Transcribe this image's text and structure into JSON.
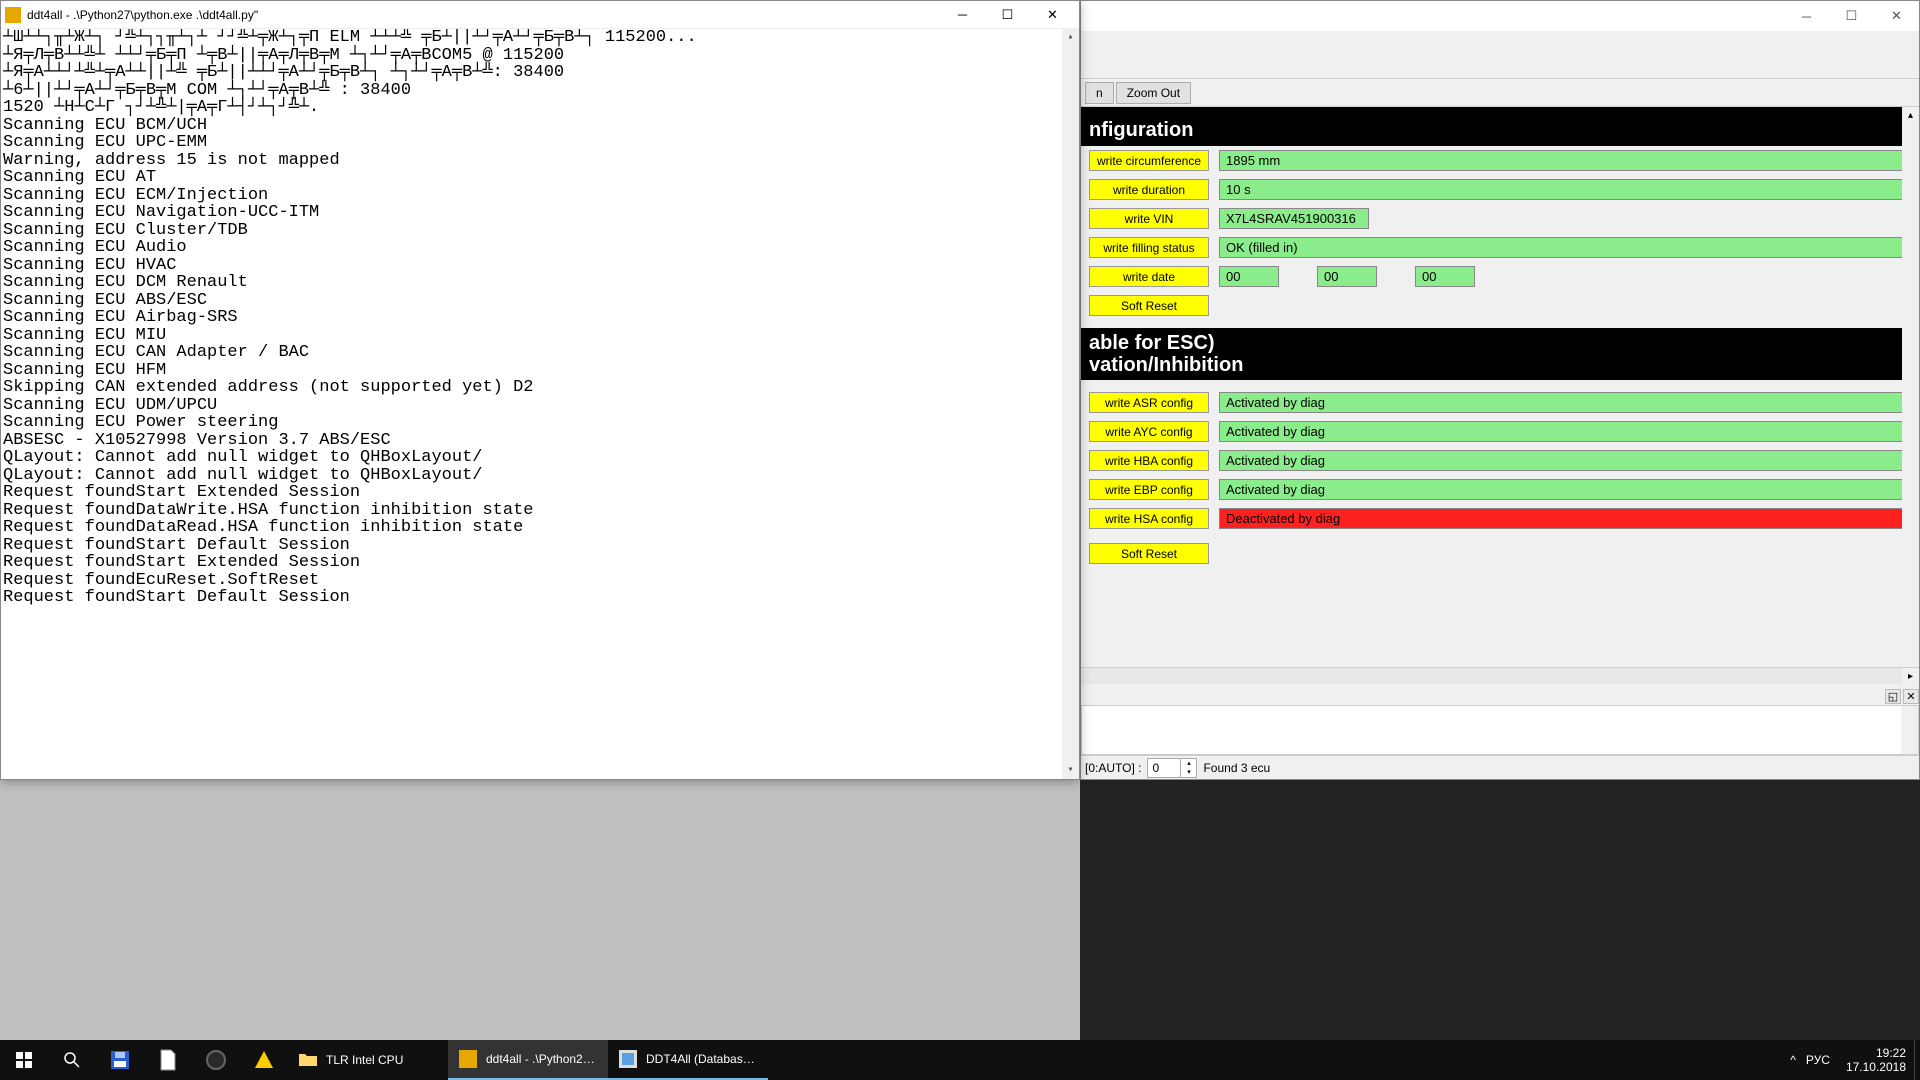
{
  "console": {
    "title": "ddt4all - .\\Python27\\python.exe .\\ddt4all.py\"",
    "lines": [
      "┴Ш┴┴┐╥┴Ж┴┐ ┘╩┴┐┐╥┴┐┴ ┘┘╩┴╤Ж┴┐╤П ELM ┴┴┴╩ ╤Б┴||┴┘╤А┴┘╤Б╤В┴┐  115200...",
      "┴Я╤Л╤В┴┴╩┴ ┴┴┘╤Б╤П ┴╤В┴||╤А╤Л╤В╤М ┴┐┴┘╤А╤ВCOM5 @ 115200",
      "┴Я╤А┴┴┘┴╩┴╤А┴┴||┴╩ ╤Б┴||┴┴┘╤А┴┘╤Б╤В┴┐ ┴┐┴┘╤А╤В┴╩: 38400",
      "┴6┴||┴┘╤А┴┘╤Б╤В╤М COM ┴┐┴┘╤А╤В┴╩ : 38400",
      "1520 ┴Н┴С┴Г ┐┘┴╩┴|╤А╤Г┴┤┘┴┐┘╩┴.",
      "Scanning ECU BCM/UCH",
      "Scanning ECU UPC-EMM",
      "Warning, address 15 is not mapped",
      "Scanning ECU AT",
      "Scanning ECU ECM/Injection",
      "Scanning ECU Navigation-UCC-ITM",
      "Scanning ECU Cluster/TDB",
      "Scanning ECU Audio",
      "Scanning ECU HVAC",
      "Scanning ECU DCM Renault",
      "Scanning ECU ABS/ESC",
      "Scanning ECU Airbag-SRS",
      "Scanning ECU MIU",
      "Scanning ECU CAN Adapter / BAC",
      "Scanning ECU HFM",
      "Skipping CAN extended address (not supported yet)  D2",
      "Scanning ECU UDM/UPCU",
      "Scanning ECU Power steering",
      "ABSESC - X10527998 Version 3.7 ABS/ESC",
      "QLayout: Cannot add null widget to QHBoxLayout/",
      "QLayout: Cannot add null widget to QHBoxLayout/",
      "Request foundStart Extended Session",
      "Request foundDataWrite.HSA function inhibition state",
      "Request foundDataRead.HSA function inhibition state",
      "Request foundStart Default Session",
      "Request foundStart Extended Session",
      "Request foundEcuReset.SoftReset",
      "Request foundStart Default Session"
    ]
  },
  "ddt": {
    "toolbar": {
      "zoom_in_partial": "n",
      "zoom_out": "Zoom Out"
    },
    "sections": {
      "config_title": "nfiguration",
      "esc_title1": "able for ESC)",
      "esc_title2": "vation/Inhibition"
    },
    "config_rows": [
      {
        "btn": "write circumference",
        "val": "1895 mm"
      },
      {
        "btn": "write duration",
        "val": "10 s"
      },
      {
        "btn": "write VIN",
        "val": "X7L4SRAV451900316",
        "partial": true
      },
      {
        "btn": "write filling status",
        "val": "OK (filled in)"
      }
    ],
    "date_row": {
      "btn": "write date",
      "v1": "00",
      "v2": "00",
      "v3": "00"
    },
    "soft_reset1": "Soft Reset",
    "esc_rows": [
      {
        "btn": "write ASR config",
        "val": "Activated by diag",
        "state": "green"
      },
      {
        "btn": "write AYC config",
        "val": "Activated by diag",
        "state": "green"
      },
      {
        "btn": "write HBA config",
        "val": "Activated by diag",
        "state": "green"
      },
      {
        "btn": "write EBP config",
        "val": "Activated by diag",
        "state": "green"
      },
      {
        "btn": "write HSA config",
        "val": "Deactivated by diag",
        "state": "red"
      }
    ],
    "soft_reset2": "Soft Reset",
    "status": {
      "label": "[0:AUTO] :",
      "spinval": "0",
      "found": "Found 3 ecu"
    }
  },
  "taskbar": {
    "items": [
      {
        "label": "",
        "icon": "start"
      },
      {
        "label": "",
        "icon": "search"
      },
      {
        "label": "",
        "icon": "save"
      },
      {
        "label": "",
        "icon": "file"
      },
      {
        "label": "",
        "icon": "circle"
      },
      {
        "label": "",
        "icon": "triangle"
      },
      {
        "label": "TLR Intel CPU",
        "icon": "folder"
      },
      {
        "label": "ddt4all - .\\Python27...",
        "icon": "cmd",
        "active": true
      },
      {
        "label": "DDT4All (Database ...",
        "icon": "app",
        "running": true
      }
    ],
    "tray": {
      "chevron": "^",
      "lang": "РУС",
      "time": "19:22",
      "date": "17.10.2018"
    }
  }
}
